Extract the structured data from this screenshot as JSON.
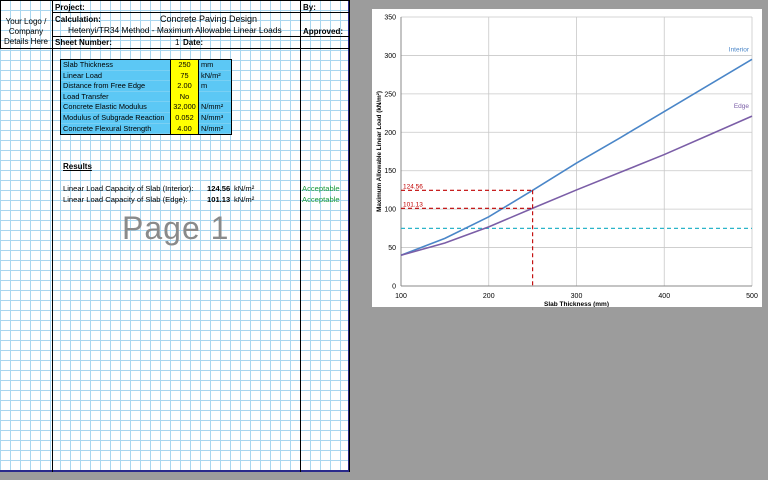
{
  "header": {
    "logo_text": "Your Logo / Company Details Here",
    "project_label": "Project:",
    "by_label": "By:",
    "calculation_label": "Calculation:",
    "calculation_title": "Concrete Paving Design",
    "calculation_subtitle": "Hetenyi/TR34 Method - Maximum Allowable Linear Loads",
    "approved_label": "Approved:",
    "sheet_number_label": "Sheet Number:",
    "sheet_number_value": "1",
    "date_label": "Date:"
  },
  "inputs": [
    {
      "label": "Slab Thickness",
      "value": "250",
      "unit": "mm"
    },
    {
      "label": "Linear Load",
      "value": "75",
      "unit": "kN/m²"
    },
    {
      "label": "Distance from Free Edge",
      "value": "2.00",
      "unit": "m"
    },
    {
      "label": "Load Transfer",
      "value": "No",
      "unit": ""
    },
    {
      "label": "Concrete Elastic Modulus",
      "value": "32,000",
      "unit": "N/mm²"
    },
    {
      "label": "Modulus of Subgrade Reaction",
      "value": "0.052",
      "unit": "N/mm³"
    },
    {
      "label": "Concrete Flexural Strength",
      "value": "4.00",
      "unit": "N/mm²"
    }
  ],
  "results": {
    "heading": "Results",
    "rows": [
      {
        "label": "Linear Load Capacity of Slab (Interior):",
        "value": "124.56",
        "unit": "kN/m²",
        "status": "Acceptable"
      },
      {
        "label": "Linear Load Capacity of Slab (Edge):",
        "value": "101.13",
        "unit": "kN/m²",
        "status": "Acceptable"
      }
    ]
  },
  "watermark": "Page 1",
  "colors": {
    "input_label_bg": "#5cc8f5",
    "input_value_bg": "#ffff00",
    "acceptable": "#1a9a3a",
    "interior_line": "#4a86c8",
    "edge_line": "#7b5ea7",
    "reference_dashed": "#c00000",
    "applied_load_dashed": "#2bb5c9"
  },
  "chart_data": {
    "type": "line",
    "xlabel": "Slab Thickness  (mm)",
    "ylabel": "Maximum Allowable Linear Load (kN/m²)",
    "xlim": [
      100,
      500
    ],
    "ylim": [
      0,
      350
    ],
    "xticks": [
      100,
      200,
      300,
      400,
      500
    ],
    "yticks": [
      0,
      50,
      100,
      150,
      200,
      250,
      300,
      350
    ],
    "grid": true,
    "series": [
      {
        "name": "Interior",
        "x": [
          100,
          150,
          200,
          250,
          300,
          350,
          400,
          450,
          500
        ],
        "y": [
          40,
          62,
          90,
          124.56,
          160,
          193,
          227,
          261,
          295
        ]
      },
      {
        "name": "Edge",
        "x": [
          100,
          150,
          200,
          250,
          300,
          350,
          400,
          450,
          500
        ],
        "y": [
          40,
          56,
          77,
          101.13,
          125,
          148,
          171,
          196,
          221
        ]
      }
    ],
    "reference_x": 250,
    "reference_lines": [
      {
        "label": "124.56",
        "y": 124.56
      },
      {
        "label": "101.13",
        "y": 101.13
      }
    ],
    "applied_load": 75
  }
}
